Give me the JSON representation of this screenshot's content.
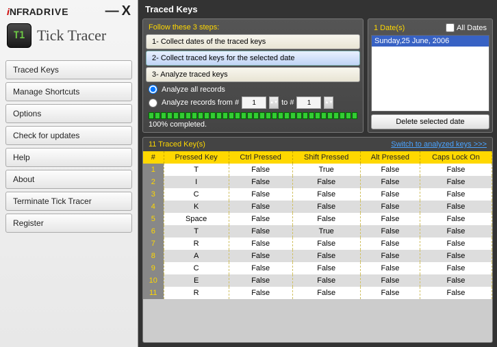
{
  "brand": {
    "prefix": "i",
    "middle": "NFRA",
    "suffix": "DRIVE"
  },
  "app_title": "Tick Tracer",
  "tt_icon_text": "T1",
  "window": {
    "min": "—",
    "close": "X"
  },
  "menu": [
    "Traced Keys",
    "Manage Shortcuts",
    "Options",
    "Check for updates",
    "Help",
    "About",
    "Terminate Tick Tracer",
    "Register"
  ],
  "main_title": "Traced Keys",
  "steps": {
    "heading": "Follow these 3 steps:",
    "items": [
      "1- Collect dates of the traced keys",
      "2- Collect traced keys for the selected date",
      "3- Analyze traced keys"
    ],
    "analyze_all": "Analyze all records",
    "analyze_range_prefix": "Analyze records from #",
    "analyze_range_mid": "to  #",
    "from_val": "1",
    "to_val": "1",
    "progress_label": "100% completed."
  },
  "dates": {
    "heading": "1 Date(s)",
    "all_label": "All Dates",
    "items": [
      "Sunday,25 June, 2006"
    ],
    "delete_label": "Delete selected date"
  },
  "keys": {
    "count_label": "11 Traced Key(s)",
    "switch_link": "Switch to analyzed keys >>>",
    "columns": [
      "#",
      "Pressed Key",
      "Ctrl Pressed",
      "Shift Pressed",
      "Alt Pressed",
      "Caps Lock On"
    ],
    "rows": [
      {
        "n": "1",
        "key": "T",
        "ctrl": "False",
        "shift": "True",
        "alt": "False",
        "caps": "False"
      },
      {
        "n": "2",
        "key": "I",
        "ctrl": "False",
        "shift": "False",
        "alt": "False",
        "caps": "False"
      },
      {
        "n": "3",
        "key": "C",
        "ctrl": "False",
        "shift": "False",
        "alt": "False",
        "caps": "False"
      },
      {
        "n": "4",
        "key": "K",
        "ctrl": "False",
        "shift": "False",
        "alt": "False",
        "caps": "False"
      },
      {
        "n": "5",
        "key": "Space",
        "ctrl": "False",
        "shift": "False",
        "alt": "False",
        "caps": "False"
      },
      {
        "n": "6",
        "key": "T",
        "ctrl": "False",
        "shift": "True",
        "alt": "False",
        "caps": "False"
      },
      {
        "n": "7",
        "key": "R",
        "ctrl": "False",
        "shift": "False",
        "alt": "False",
        "caps": "False"
      },
      {
        "n": "8",
        "key": "A",
        "ctrl": "False",
        "shift": "False",
        "alt": "False",
        "caps": "False"
      },
      {
        "n": "9",
        "key": "C",
        "ctrl": "False",
        "shift": "False",
        "alt": "False",
        "caps": "False"
      },
      {
        "n": "10",
        "key": "E",
        "ctrl": "False",
        "shift": "False",
        "alt": "False",
        "caps": "False"
      },
      {
        "n": "11",
        "key": "R",
        "ctrl": "False",
        "shift": "False",
        "alt": "False",
        "caps": "False"
      }
    ]
  }
}
